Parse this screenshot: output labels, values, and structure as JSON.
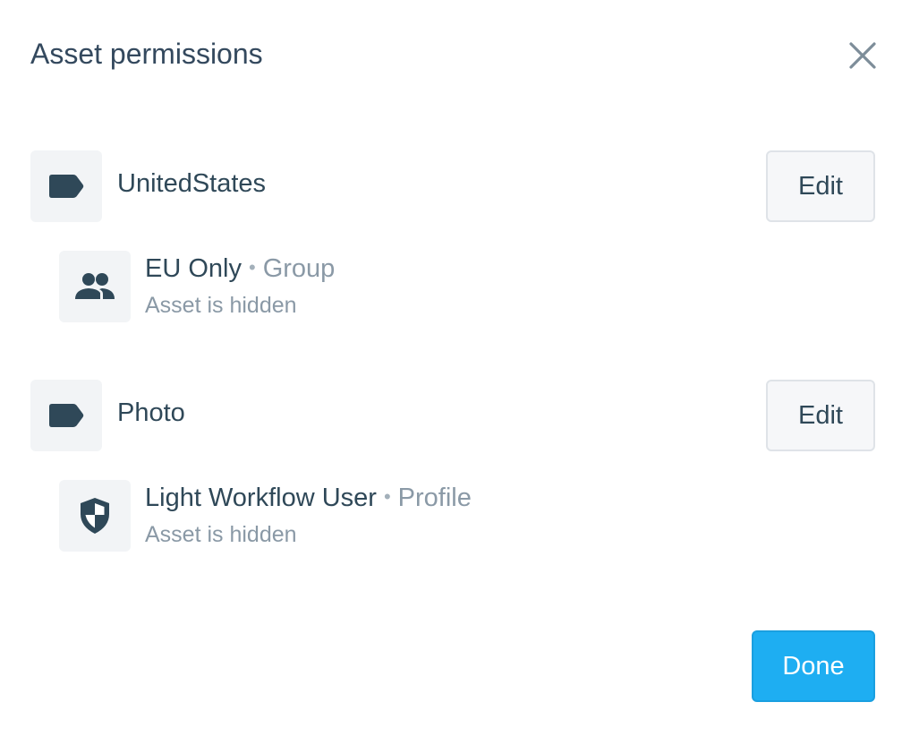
{
  "dialog": {
    "title": "Asset permissions",
    "close_icon": "close-icon",
    "done_label": "Done"
  },
  "colors": {
    "text": "#2f4858",
    "muted": "#8a99a6",
    "icon_bg": "#f2f4f6",
    "icon": "#2f4858",
    "primary": "#1eaef2"
  },
  "sections": [
    {
      "tag_icon": "tag-icon",
      "tag_name": "UnitedStates",
      "edit_label": "Edit",
      "entry": {
        "icon": "group-icon",
        "name": "EU Only",
        "separator": "•",
        "type": "Group",
        "status": "Asset is hidden"
      }
    },
    {
      "tag_icon": "tag-icon",
      "tag_name": "Photo",
      "edit_label": "Edit",
      "entry": {
        "icon": "shield-icon",
        "name": "Light Workflow User",
        "separator": "•",
        "type": "Profile",
        "status": "Asset is hidden"
      }
    }
  ]
}
